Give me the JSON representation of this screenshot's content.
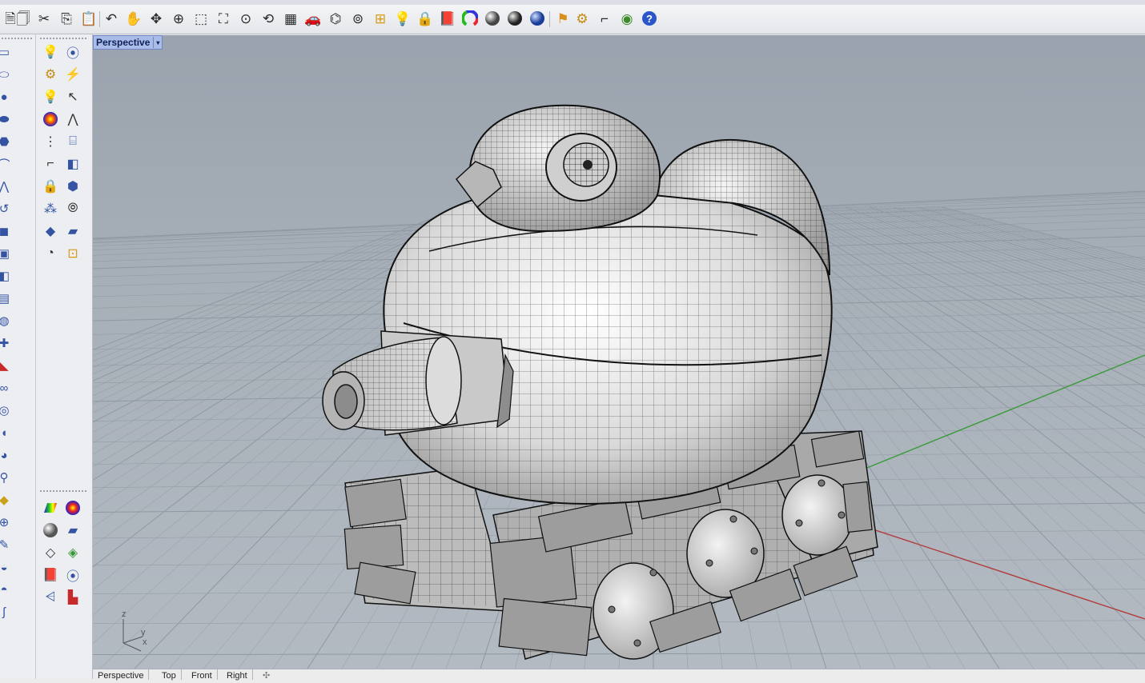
{
  "viewport": {
    "title": "Perspective",
    "dropdown_glyph": "▾",
    "axis_labels": {
      "z": "z",
      "y": "y",
      "x": "x"
    }
  },
  "tabs": [
    "Perspective",
    "Top",
    "Front",
    "Right"
  ],
  "tabs_add_glyph": "✣",
  "toolbar": {
    "icons": [
      "new-document",
      "save",
      "cut",
      "copy",
      "paste",
      "undo",
      "pan",
      "rotate-view",
      "zoom-dynamic",
      "zoom-window",
      "zoom-extents",
      "zoom-selected",
      "undo-view",
      "four-viewports",
      "car-render",
      "wireframe",
      "point-osnap",
      "grid-snap",
      "light-bulb",
      "lock",
      "book-render",
      "color-wheel",
      "shaded-sphere",
      "rendered-sphere",
      "blue-sphere",
      "flag-filter",
      "gear-options",
      "dimension-tool",
      "globe-plugin",
      "help"
    ]
  },
  "colors": {
    "x_axis": "#b13a3a",
    "y_axis": "#3a9a3a",
    "grid": "#8f98a2",
    "title_bg": "#a9bde8"
  }
}
